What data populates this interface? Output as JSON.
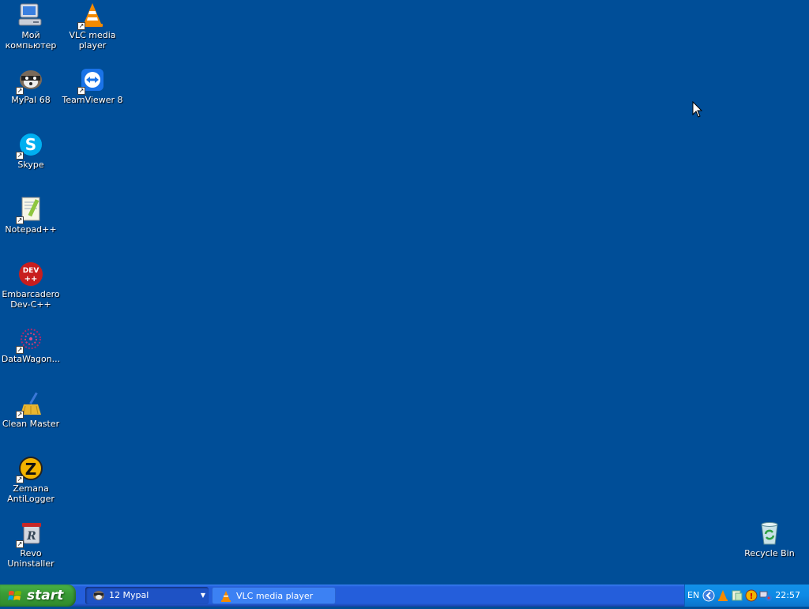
{
  "desktop": {
    "background": "#004e98",
    "icons": [
      {
        "label": "Мой компьютер",
        "icon": "my-computer-icon"
      },
      {
        "label": "VLC media player",
        "icon": "vlc-icon"
      },
      {
        "label": "MyPal 68",
        "icon": "mypal-icon"
      },
      {
        "label": "TeamViewer 8",
        "icon": "teamviewer-icon"
      },
      {
        "label": "Skype",
        "icon": "skype-icon"
      },
      {
        "label": "Notepad++",
        "icon": "notepad-plus-plus-icon"
      },
      {
        "label": "Embarcadero Dev-C++",
        "icon": "devcpp-icon"
      },
      {
        "label": "DataWagon...",
        "icon": "datawagon-icon"
      },
      {
        "label": "Clean Master",
        "icon": "clean-master-icon"
      },
      {
        "label": "Zemana AntiLogger",
        "icon": "zemana-icon"
      },
      {
        "label": "Revo Uninstaller",
        "icon": "revo-uninstaller-icon"
      },
      {
        "label": "Recycle Bin",
        "icon": "recycle-bin-icon"
      }
    ]
  },
  "taskbar": {
    "start_label": "start",
    "tasks": [
      {
        "label": "12 Mypal",
        "icon": "mypal-icon",
        "state": "active"
      },
      {
        "label": "VLC media player",
        "icon": "vlc-icon",
        "state": "normal"
      }
    ],
    "tray": {
      "language": "EN",
      "clock": "22:57",
      "icons": [
        "back-arrow-icon",
        "vlc-tray-icon",
        "network-icon",
        "security-alert-icon",
        "network-connections-icon"
      ]
    }
  }
}
